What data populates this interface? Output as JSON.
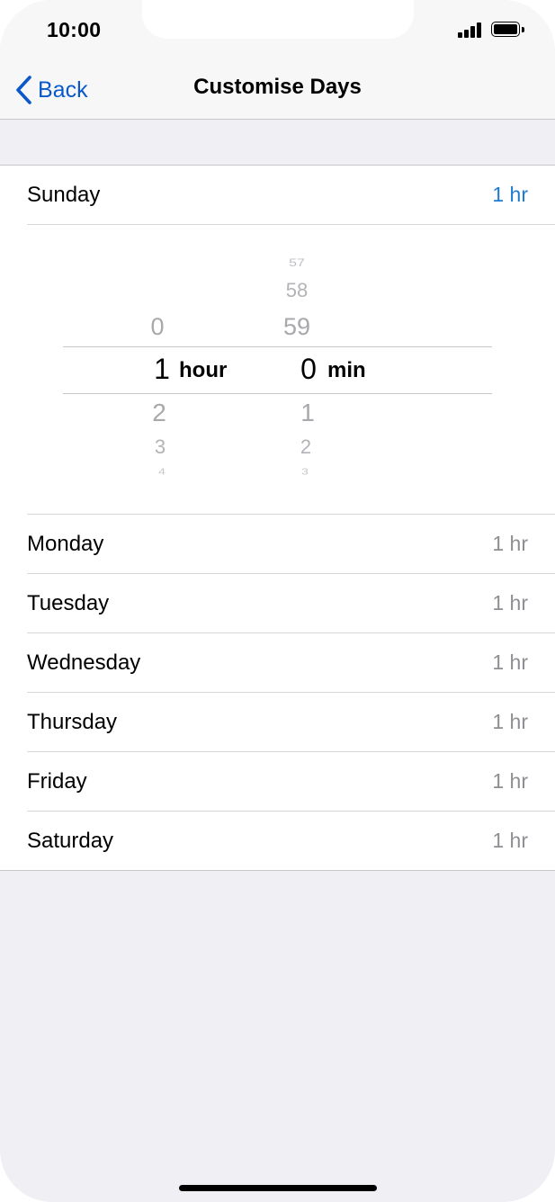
{
  "status_bar": {
    "time": "10:00"
  },
  "nav": {
    "back_label": "Back",
    "title": "Customise Days"
  },
  "days": [
    {
      "name": "Sunday",
      "value": "1 hr",
      "active": true
    },
    {
      "name": "Monday",
      "value": "1 hr"
    },
    {
      "name": "Tuesday",
      "value": "1 hr"
    },
    {
      "name": "Wednesday",
      "value": "1 hr"
    },
    {
      "name": "Thursday",
      "value": "1 hr"
    },
    {
      "name": "Friday",
      "value": "1 hr"
    },
    {
      "name": "Saturday",
      "value": "1 hr"
    }
  ],
  "picker": {
    "hours": {
      "above": [
        "0"
      ],
      "selected": "1",
      "below": [
        "2",
        "3",
        "4"
      ],
      "unit": "hour"
    },
    "minutes": {
      "above": [
        "57",
        "58",
        "59"
      ],
      "selected": "0",
      "below": [
        "1",
        "2",
        "3"
      ],
      "unit": "min"
    }
  },
  "colors": {
    "accent": "#0a58ca",
    "active_value": "#1e7bd4",
    "background": "#efeff4"
  }
}
